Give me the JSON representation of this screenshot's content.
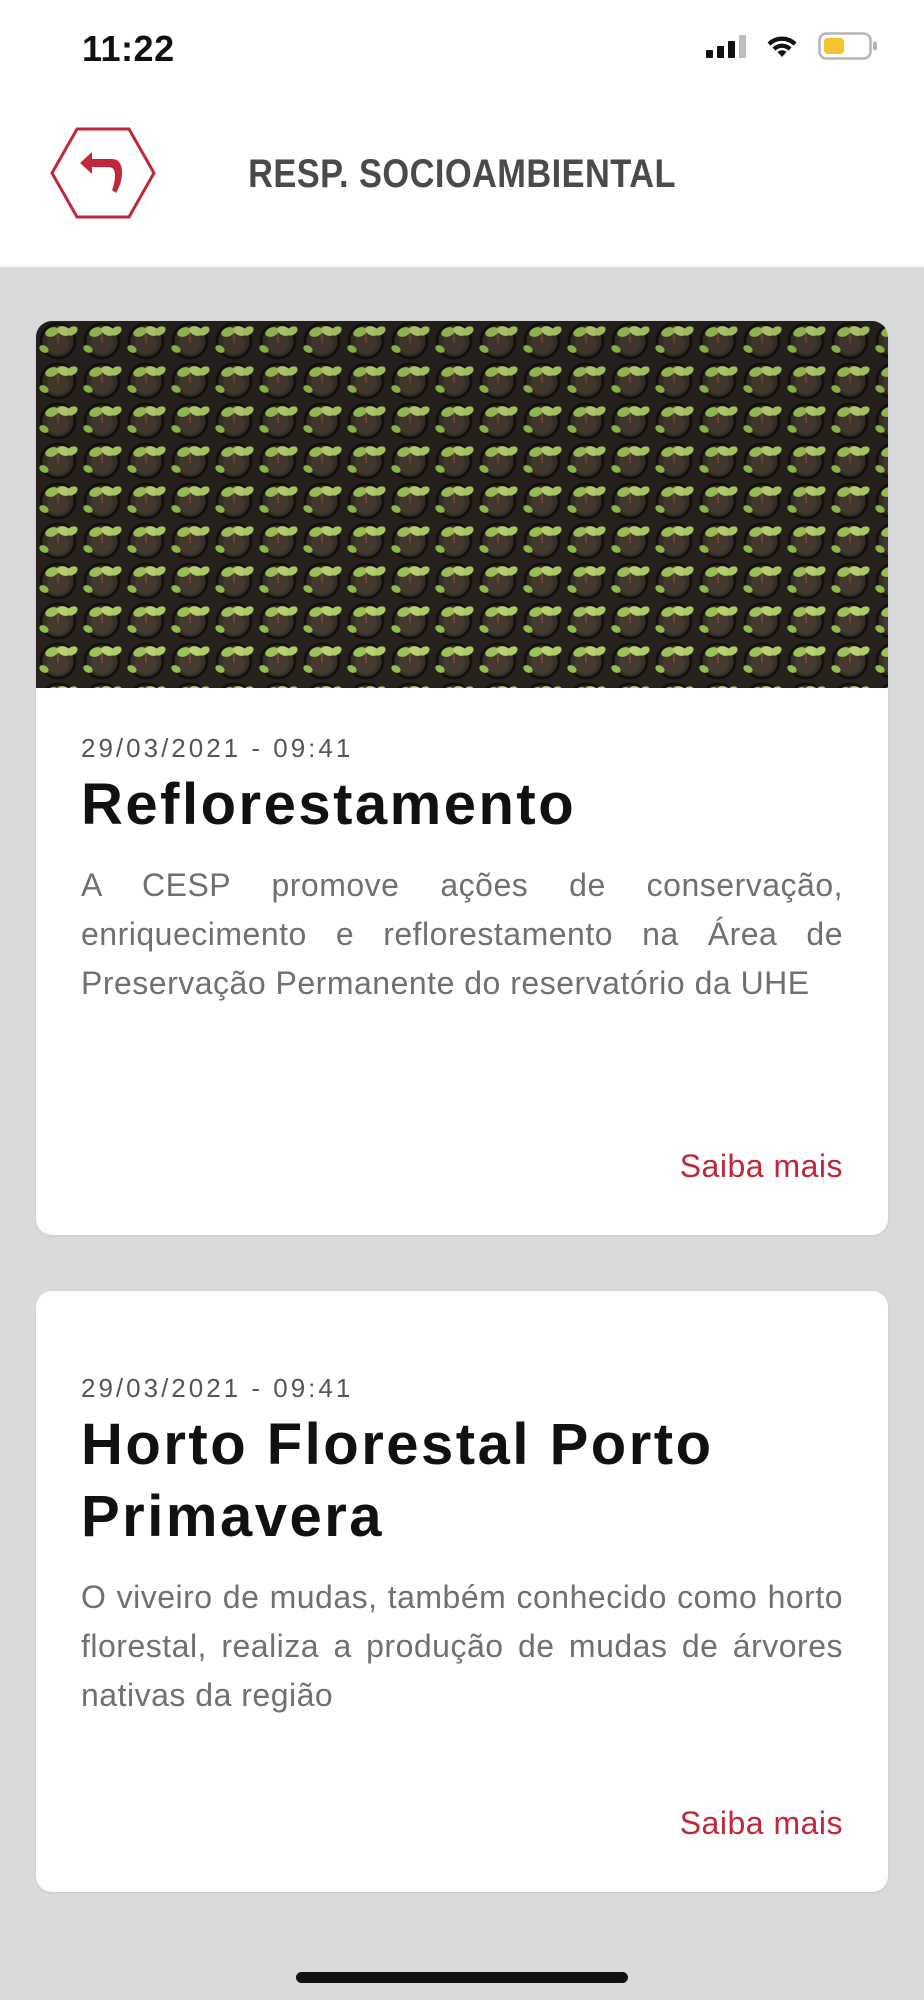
{
  "status": {
    "time": "11:22"
  },
  "header": {
    "title": "RESP. SOCIOAMBIENTAL",
    "back_icon": "back-arrow-icon",
    "accent": "#c0273a"
  },
  "cards": [
    {
      "image": "seedlings-photo",
      "date": "29/03/2021 - 09:41",
      "title": "Reflorestamento",
      "text": "A CESP promove ações de conservação, enriquecimento e reflorestamento na Área de Preservação Permanente do reservatório da UHE",
      "link": "Saiba mais"
    },
    {
      "date": "29/03/2021 - 09:41",
      "title": "Horto Florestal Porto Primavera",
      "text": "O viveiro de mudas, também conhecido como horto florestal, realiza a produção de mudas de árvores nativas da região",
      "link": "Saiba mais"
    }
  ],
  "colors": {
    "background": "#d9dadc",
    "card": "#ffffff",
    "link": "#c0273a",
    "title": "#4a4a4a"
  }
}
